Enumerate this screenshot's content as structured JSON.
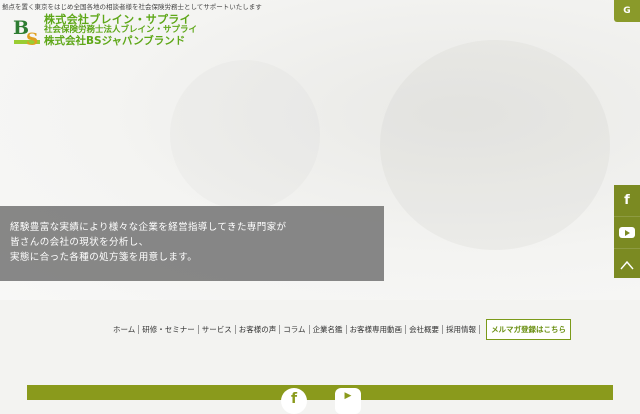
{
  "header": {
    "tagline": "拠点を置く東京をはじめ全国各地の相談者様を社会保険労務士としてサポートいたします",
    "logo": {
      "mark_letters": "BS",
      "line1": "株式会社ブレイン・サプライ",
      "line2": "社会保険労務士法人ブレイン・サプライ",
      "line3": "株式会社BSジャパンブランド"
    },
    "translate_label": "G"
  },
  "hero": {
    "lines": [
      "経験豊富な実績により様々な企業を経営指導してきた専門家が",
      "皆さんの会社の現状を分析し、",
      "実態に合った各種の処方箋を用意します。"
    ]
  },
  "side_social": {
    "facebook_label": "f",
    "youtube_label": "▶",
    "top_label": "︿"
  },
  "nav": {
    "items": [
      "ホーム",
      "研修・セミナー",
      "サービス",
      "お客様の声",
      "コラム",
      "企業名鑑",
      "お客様専用動画",
      "会社概要",
      "採用情報"
    ],
    "mail_button": "メルマガ登録はこちら"
  },
  "footer": {
    "facebook_label": "f",
    "youtube_label": "▶"
  },
  "colors": {
    "brand_green": "#5ea718",
    "olive": "#8a9a1c"
  }
}
